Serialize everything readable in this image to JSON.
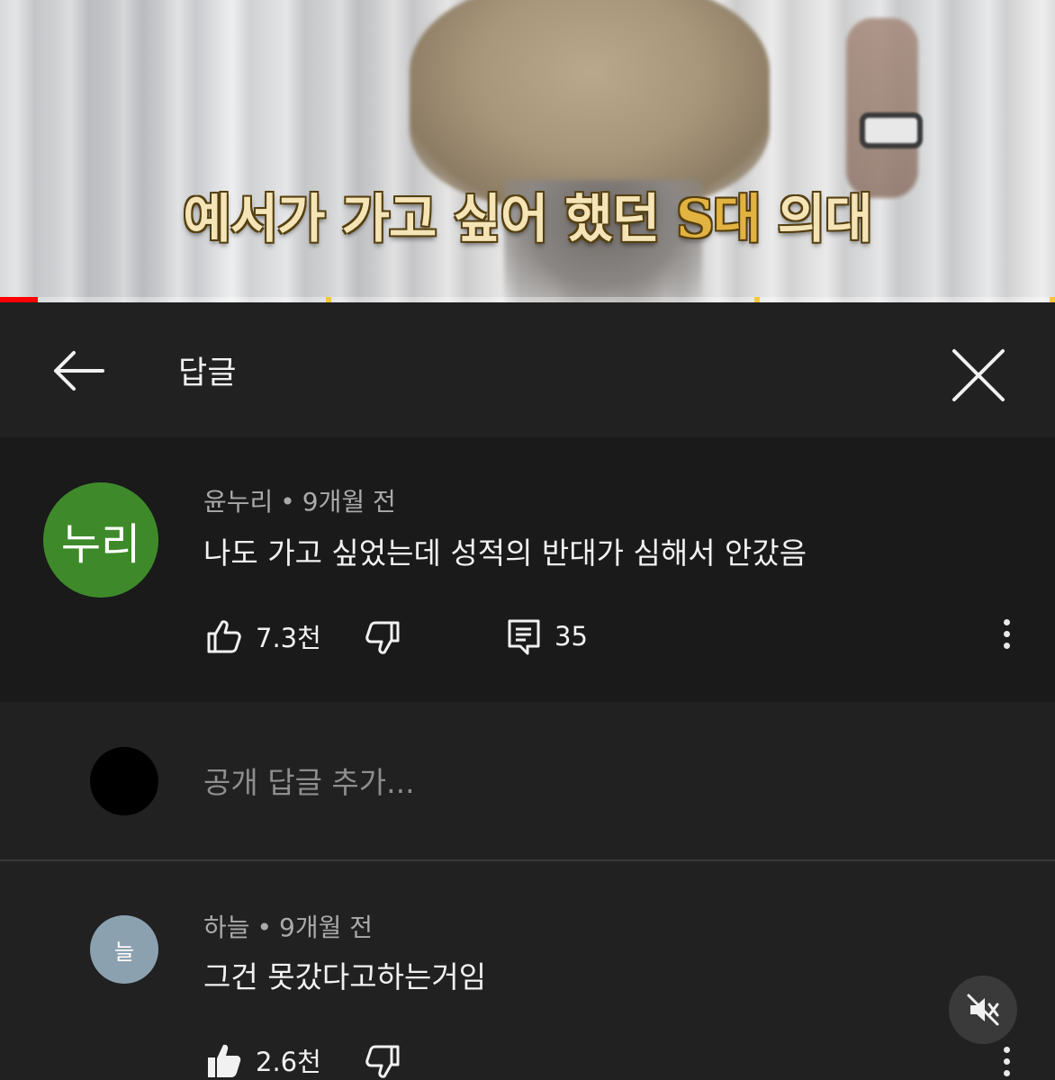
{
  "video": {
    "caption_before": "예서가 가고 싶어 했던 ",
    "caption_highlight": "S대",
    "caption_after": " 의대",
    "progress_fraction": 0.036
  },
  "header": {
    "back_icon": "arrow-left-icon",
    "title": "답글",
    "close_icon": "close-icon"
  },
  "main_comment": {
    "avatar_text": "누리",
    "avatar_color": "#3e8a2a",
    "author": "윤누리",
    "separator": "•",
    "time": "9개월 전",
    "text": "나도 가고 싶었는데 성적의 반대가 심해서 안갔음",
    "likes": "7.3천",
    "replies": "35",
    "icons": [
      "thumbs-up-icon",
      "thumbs-down-icon",
      "comment-icon",
      "more-vert-icon"
    ]
  },
  "reply_input": {
    "placeholder": "공개 답글 추가..."
  },
  "reply_comment": {
    "avatar_text": "늘",
    "avatar_color": "#8ca1b0",
    "author": "하늘",
    "separator": "•",
    "time": "9개월 전",
    "text": "그건 못갔다고하는거임",
    "likes": "2.6천",
    "icons": [
      "thumbs-up-filled-icon",
      "thumbs-down-icon",
      "more-vert-icon"
    ]
  },
  "overlay": {
    "mute_icon": "volume-off-icon"
  }
}
